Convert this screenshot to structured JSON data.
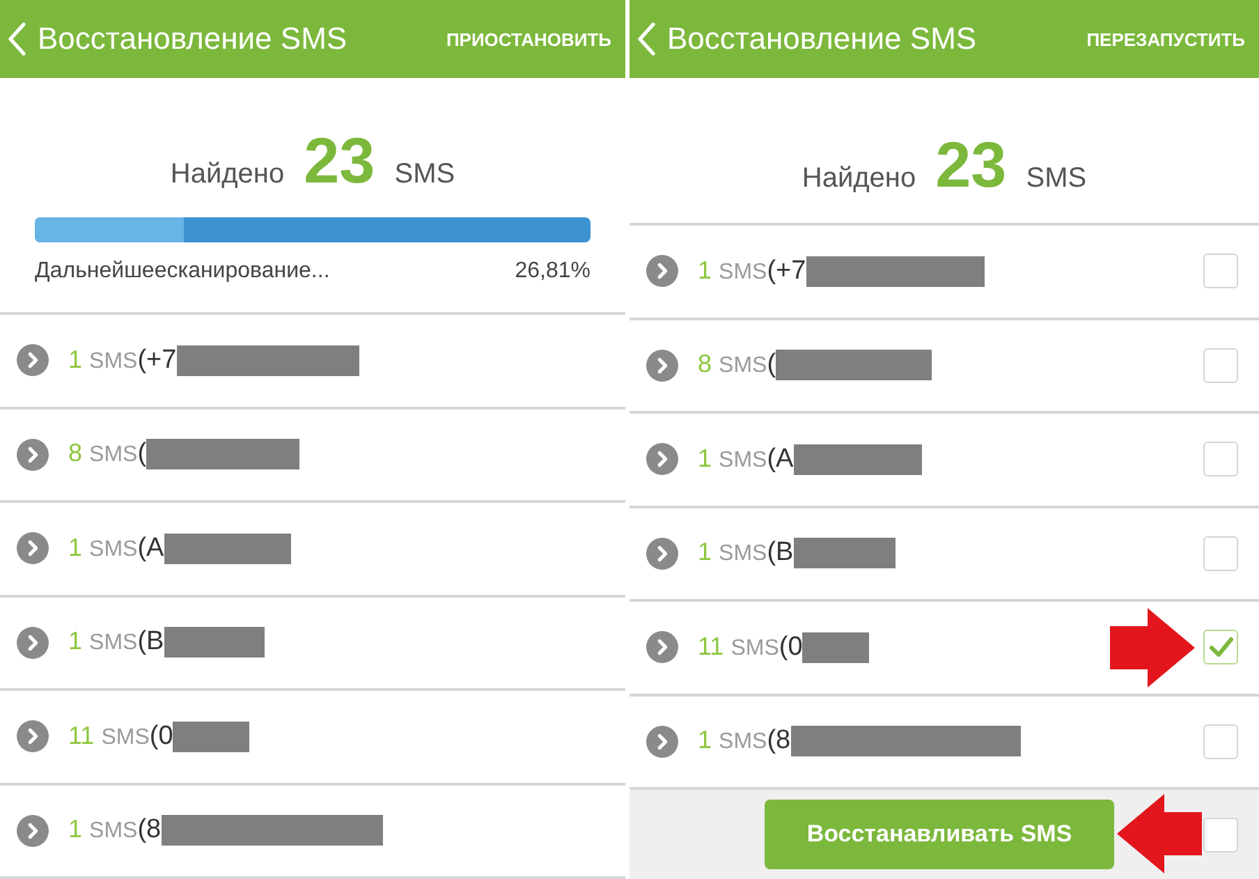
{
  "screens": [
    {
      "title": "Восстановление SMS",
      "action": "ПРИОСТАНОВИТЬ",
      "found": {
        "label": "Найдено",
        "count": "23",
        "unit": "SMS"
      },
      "progress": {
        "level": 0.2681,
        "status": "Дальнейшеесканирование...",
        "percent": "26,81%"
      },
      "rows": [
        {
          "count": "1",
          "unit": "SMS",
          "name": "(+7"
        },
        {
          "count": "8",
          "unit": "SMS",
          "name": "("
        },
        {
          "count": "1",
          "unit": "SMS",
          "name": "(A"
        },
        {
          "count": "1",
          "unit": "SMS",
          "name": "(B"
        },
        {
          "count": "11",
          "unit": "SMS",
          "name": "(0"
        },
        {
          "count": "1",
          "unit": "SMS",
          "name": "(8"
        }
      ]
    },
    {
      "title": "Восстановление SMS",
      "action": "ПЕРЕЗАПУСТИТЬ",
      "found": {
        "label": "Найдено",
        "count": "23",
        "unit": "SMS"
      },
      "rows": [
        {
          "count": "1",
          "unit": "SMS",
          "name": "(+7",
          "checked": false,
          "pointer_arrow": false
        },
        {
          "count": "8",
          "unit": "SMS",
          "name": "(",
          "checked": false,
          "pointer_arrow": false
        },
        {
          "count": "1",
          "unit": "SMS",
          "name": "(A",
          "checked": false,
          "pointer_arrow": false
        },
        {
          "count": "1",
          "unit": "SMS",
          "name": "(B",
          "checked": false,
          "pointer_arrow": false
        },
        {
          "count": "11",
          "unit": "SMS",
          "name": "(0",
          "checked": true,
          "pointer_arrow": true
        },
        {
          "count": "1",
          "unit": "SMS",
          "name": "(8",
          "checked": false,
          "pointer_arrow": false
        }
      ],
      "footer": {
        "button": "Восстанавливать SMS",
        "select_all_checked": false,
        "pointer_arrow": true
      }
    }
  ]
}
